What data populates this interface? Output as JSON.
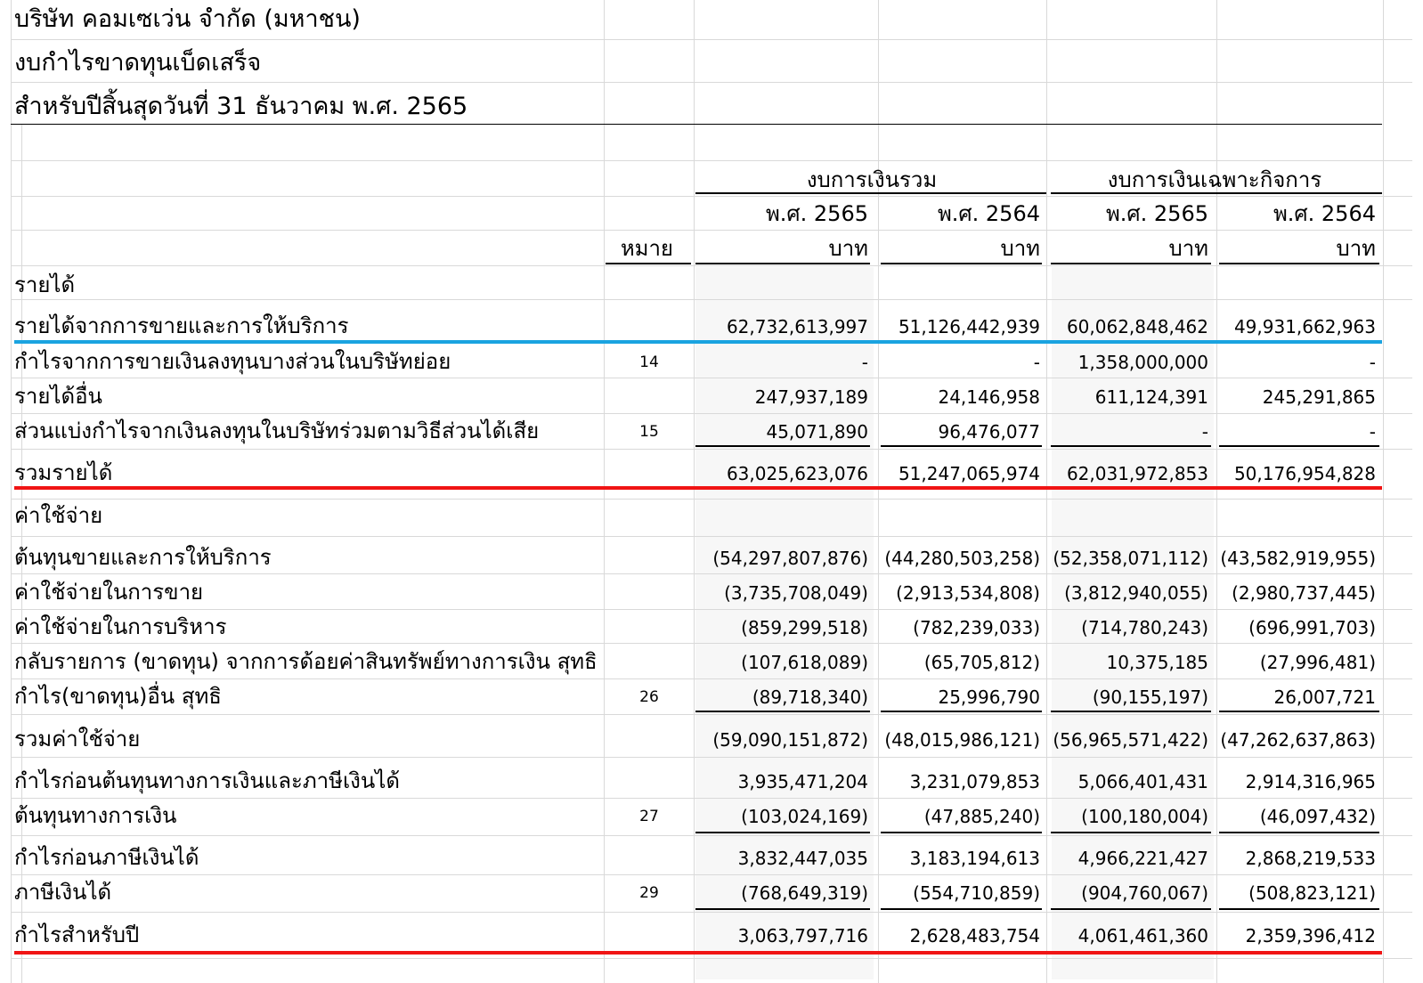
{
  "header": {
    "company": "บริษัท คอมเซเว่น จำกัด (มหาชน)",
    "statement": "งบกำไรขาดทุนเบ็ดเสร็จ",
    "period": "สำหรับปีสิ้นสุดวันที่ 31 ธันวาคม พ.ศ. 2565"
  },
  "columns": {
    "group_consolidated": "งบการเงินรวม",
    "group_separate": "งบการเงินเฉพาะกิจการ",
    "years": [
      "พ.ศ. 2565",
      "พ.ศ. 2564",
      "พ.ศ. 2565",
      "พ.ศ. 2564"
    ],
    "note_header": "หมาย",
    "unit": "บาท"
  },
  "rows": [
    {
      "label": "รายได้",
      "note": "",
      "values": [
        "",
        "",
        "",
        ""
      ]
    },
    {
      "label": "รายได้จากการขายและการให้บริการ",
      "note": "",
      "values": [
        "62,732,613,997",
        "51,126,442,939",
        "60,062,848,462",
        "49,931,662,963"
      ]
    },
    {
      "label": "กำไรจากการขายเงินลงทุนบางส่วนในบริษัทย่อย",
      "note": "14",
      "values": [
        "-",
        "-",
        "1,358,000,000",
        "-"
      ]
    },
    {
      "label": "รายได้อื่น",
      "note": "",
      "values": [
        "247,937,189",
        "24,146,958",
        "611,124,391",
        "245,291,865"
      ]
    },
    {
      "label": "ส่วนแบ่งกำไรจากเงินลงทุนในบริษัทร่วมตามวิธีส่วนได้เสีย",
      "note": "15",
      "values": [
        "45,071,890",
        "96,476,077",
        "-",
        "-"
      ]
    },
    {
      "label": "รวมรายได้",
      "note": "",
      "values": [
        "63,025,623,076",
        "51,247,065,974",
        "62,031,972,853",
        "50,176,954,828"
      ]
    },
    {
      "label": "ค่าใช้จ่าย",
      "note": "",
      "values": [
        "",
        "",
        "",
        ""
      ]
    },
    {
      "label": "ต้นทุนขายและการให้บริการ",
      "note": "",
      "values": [
        "(54,297,807,876)",
        "(44,280,503,258)",
        "(52,358,071,112)",
        "(43,582,919,955)"
      ]
    },
    {
      "label": "ค่าใช้จ่ายในการขาย",
      "note": "",
      "values": [
        "(3,735,708,049)",
        "(2,913,534,808)",
        "(3,812,940,055)",
        "(2,980,737,445)"
      ]
    },
    {
      "label": "ค่าใช้จ่ายในการบริหาร",
      "note": "",
      "values": [
        "(859,299,518)",
        "(782,239,033)",
        "(714,780,243)",
        "(696,991,703)"
      ]
    },
    {
      "label": "กลับรายการ (ขาดทุน) จากการด้อยค่าสินทรัพย์ทางการเงิน สุทธิ",
      "note": "",
      "values": [
        "(107,618,089)",
        "(65,705,812)",
        "10,375,185",
        "(27,996,481)"
      ]
    },
    {
      "label": "กำไร(ขาดทุน)อื่น สุทธิ",
      "note": "26",
      "values": [
        "(89,718,340)",
        "25,996,790",
        "(90,155,197)",
        "26,007,721"
      ]
    },
    {
      "label": "รวมค่าใช้จ่าย",
      "note": "",
      "values": [
        "(59,090,151,872)",
        "(48,015,986,121)",
        "(56,965,571,422)",
        "(47,262,637,863)"
      ]
    },
    {
      "label": "กำไรก่อนต้นทุนทางการเงินและภาษีเงินได้",
      "note": "",
      "values": [
        "3,935,471,204",
        "3,231,079,853",
        "5,066,401,431",
        "2,914,316,965"
      ]
    },
    {
      "label": "ต้นทุนทางการเงิน",
      "note": "27",
      "values": [
        "(103,024,169)",
        "(47,885,240)",
        "(100,180,004)",
        "(46,097,432)"
      ]
    },
    {
      "label": "กำไรก่อนภาษีเงินได้",
      "note": "",
      "values": [
        "3,832,447,035",
        "3,183,194,613",
        "4,966,221,427",
        "2,868,219,533"
      ]
    },
    {
      "label": "ภาษีเงินได้",
      "note": "29",
      "values": [
        "(768,649,319)",
        "(554,710,859)",
        "(904,760,067)",
        "(508,823,121)"
      ]
    },
    {
      "label": "กำไรสำหรับปี",
      "note": "",
      "values": [
        "3,063,797,716",
        "2,628,483,754",
        "4,061,461,360",
        "2,359,396,412"
      ]
    }
  ],
  "highlights": {
    "blue": "#1aa3e0",
    "red": "#f01414"
  }
}
